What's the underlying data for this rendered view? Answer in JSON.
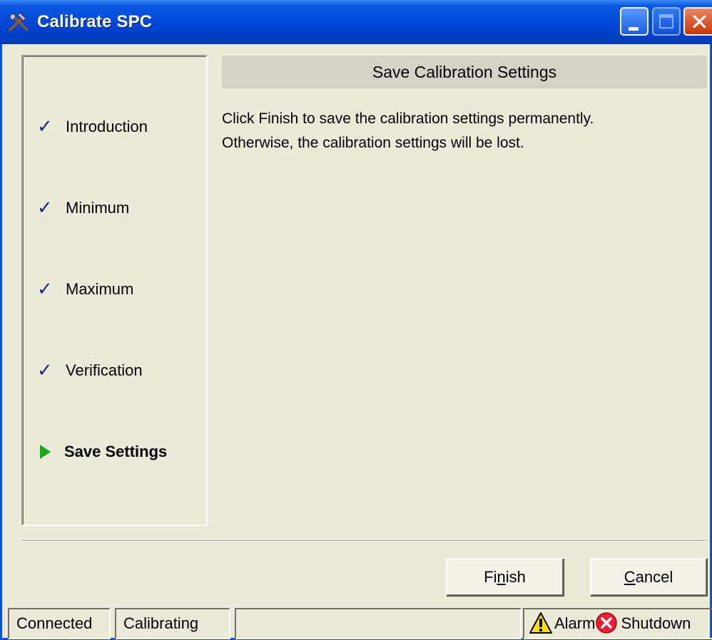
{
  "window": {
    "title": "Calibrate SPC"
  },
  "steps": [
    {
      "label": "Introduction",
      "state": "done"
    },
    {
      "label": "Minimum",
      "state": "done"
    },
    {
      "label": "Maximum",
      "state": "done"
    },
    {
      "label": "Verification",
      "state": "done"
    },
    {
      "label": "Save Settings",
      "state": "current"
    }
  ],
  "content": {
    "header": "Save Calibration Settings",
    "line1": "Click Finish to save the calibration settings permanently.",
    "line2": "Otherwise, the calibration settings will be lost."
  },
  "buttons": {
    "finish": "Finish",
    "finish_mnemonic": "n",
    "cancel": "Cancel",
    "cancel_mnemonic": "C"
  },
  "status": {
    "connection": "Connected",
    "mode": "Calibrating",
    "message": "",
    "alarm": "Alarm",
    "shutdown": "Shutdown"
  },
  "icons": {
    "title": "tools-icon",
    "done": "checkmark-icon",
    "current": "green-arrow-icon",
    "alarm": "warning-icon",
    "shutdown": "error-icon"
  },
  "colors": {
    "titlebar": "#0046d5",
    "face": "#ece9d8",
    "header_bar": "#d6d3c6",
    "current_arrow": "#18a818",
    "check": "#1c2a7a"
  }
}
